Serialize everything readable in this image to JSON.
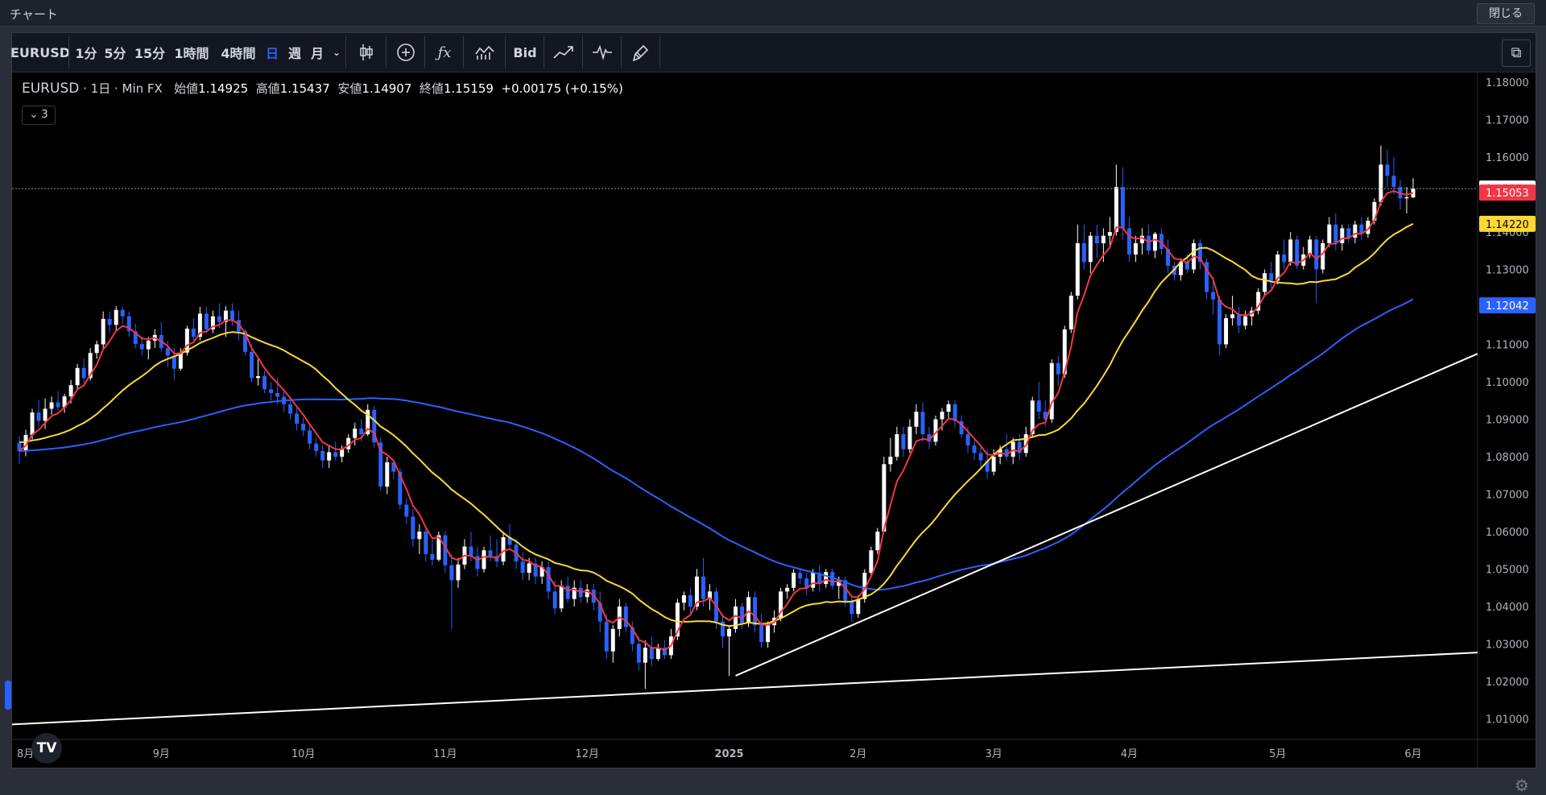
{
  "window": {
    "title": "チャート",
    "close_label": "閉じる"
  },
  "toolbar": {
    "symbol": "EURUSD",
    "intervals": [
      "1分",
      "5分",
      "15分",
      "1時間",
      "4時間",
      "日",
      "週",
      "月"
    ],
    "active_interval": "日",
    "bid_label": "Bid",
    "icons": [
      "dropdown-chevron-icon",
      "candle-style-icon",
      "add-compare-icon",
      "indicators-icon",
      "templates-icon",
      "replay-line-icon",
      "pulse-icon",
      "brush-icon",
      "layout-icon"
    ]
  },
  "legend": {
    "symbol": "EURUSD",
    "interval": "1日",
    "source": "Min FX",
    "open_label": "始値",
    "open": "1.14925",
    "high_label": "高値",
    "high": "1.15437",
    "low_label": "安値",
    "low": "1.14907",
    "close_label": "終値",
    "close": "1.15159",
    "change": "+0.00175 (+0.15%)",
    "collapse_count": "3",
    "colors": {
      "up": "#ffffff",
      "down": "#2962ff"
    }
  },
  "chart_data": {
    "type": "candlestick",
    "y_ticks": [
      "1.18000",
      "1.17000",
      "1.16000",
      "1.15000",
      "1.14000",
      "1.13000",
      "1.12000",
      "1.11000",
      "1.10000",
      "1.09000",
      "1.08000",
      "1.07000",
      "1.06000",
      "1.05000",
      "1.04000",
      "1.03000",
      "1.02000",
      "1.01000"
    ],
    "y_range": [
      1.0045,
      1.1826
    ],
    "x_labels": [
      "8月",
      "9月",
      "10月",
      "11月",
      "12月",
      "2025",
      "2月",
      "3月",
      "4月",
      "5月",
      "6月"
    ],
    "price_tags": [
      {
        "value": "1.15159",
        "color": "#ffffff"
      },
      {
        "value": "1.15053",
        "color": "#f23645"
      },
      {
        "value": "1.14220",
        "color": "#fdd835"
      },
      {
        "value": "1.12042",
        "color": "#2962ff"
      }
    ],
    "candles": [
      [
        1.0836,
        1.0855,
        1.078,
        1.0815
      ],
      [
        1.0815,
        1.0872,
        1.0801,
        1.0858
      ],
      [
        1.0858,
        1.0928,
        1.0846,
        1.0918
      ],
      [
        1.0918,
        1.0952,
        1.088,
        1.0896
      ],
      [
        1.0896,
        1.0955,
        1.0874,
        1.0928
      ],
      [
        1.0928,
        1.0961,
        1.0912,
        1.0945
      ],
      [
        1.0945,
        1.0975,
        1.0925,
        1.0932
      ],
      [
        1.0932,
        1.0968,
        1.0917,
        1.0961
      ],
      [
        1.0961,
        1.1005,
        1.0942,
        1.0991
      ],
      [
        1.0991,
        1.1048,
        1.0977,
        1.1037
      ],
      [
        1.1037,
        1.1062,
        1.0996,
        1.101
      ],
      [
        1.101,
        1.109,
        1.1003,
        1.1077
      ],
      [
        1.1077,
        1.111,
        1.1062,
        1.11
      ],
      [
        1.11,
        1.1188,
        1.1085,
        1.1168
      ],
      [
        1.1168,
        1.1188,
        1.113,
        1.1152
      ],
      [
        1.1152,
        1.1202,
        1.1135,
        1.1192
      ],
      [
        1.1192,
        1.12,
        1.1155,
        1.1175
      ],
      [
        1.1175,
        1.1188,
        1.112,
        1.1135
      ],
      [
        1.1135,
        1.1155,
        1.1089,
        1.1101
      ],
      [
        1.1101,
        1.112,
        1.107,
        1.1087
      ],
      [
        1.1087,
        1.112,
        1.106,
        1.111
      ],
      [
        1.111,
        1.114,
        1.109,
        1.1125
      ],
      [
        1.1125,
        1.116,
        1.108,
        1.109
      ],
      [
        1.109,
        1.111,
        1.104,
        1.107
      ],
      [
        1.107,
        1.109,
        1.1005,
        1.1035
      ],
      [
        1.1035,
        1.109,
        1.103,
        1.1078
      ],
      [
        1.1078,
        1.115,
        1.107,
        1.1142
      ],
      [
        1.1142,
        1.117,
        1.111,
        1.112
      ],
      [
        1.112,
        1.12,
        1.111,
        1.1182
      ],
      [
        1.1182,
        1.12,
        1.113,
        1.114
      ],
      [
        1.114,
        1.119,
        1.113,
        1.1175
      ],
      [
        1.1175,
        1.121,
        1.1145,
        1.116
      ],
      [
        1.116,
        1.1202,
        1.112,
        1.119
      ],
      [
        1.119,
        1.121,
        1.115,
        1.1165
      ],
      [
        1.1165,
        1.119,
        1.111,
        1.1135
      ],
      [
        1.1135,
        1.114,
        1.107,
        1.108
      ],
      [
        1.108,
        1.11,
        1.1,
        1.101
      ],
      [
        1.101,
        1.106,
        1.099,
        1.1015
      ],
      [
        1.1015,
        1.103,
        1.097,
        1.098
      ],
      [
        1.098,
        1.1,
        1.095,
        1.097
      ],
      [
        1.097,
        1.101,
        1.094,
        1.096
      ],
      [
        1.096,
        1.098,
        1.092,
        1.094
      ],
      [
        1.094,
        1.096,
        1.09,
        1.0915
      ],
      [
        1.0915,
        1.093,
        1.087,
        1.0888
      ],
      [
        1.0888,
        1.0905,
        1.0855,
        1.087
      ],
      [
        1.087,
        1.0885,
        1.082,
        1.0835
      ],
      [
        1.0835,
        1.085,
        1.08,
        1.0815
      ],
      [
        1.0815,
        1.083,
        1.077,
        1.079
      ],
      [
        1.079,
        1.083,
        1.077,
        1.0812
      ],
      [
        1.0812,
        1.084,
        1.079,
        1.08
      ],
      [
        1.08,
        1.083,
        1.0785,
        1.082
      ],
      [
        1.082,
        1.086,
        1.081,
        1.085
      ],
      [
        1.085,
        1.089,
        1.083,
        1.0875
      ],
      [
        1.0875,
        1.09,
        1.084,
        1.086
      ],
      [
        1.086,
        1.094,
        1.0855,
        1.0925
      ],
      [
        1.0925,
        1.0935,
        1.0825,
        1.0838
      ],
      [
        1.0838,
        1.085,
        1.071,
        1.072
      ],
      [
        1.072,
        1.08,
        1.07,
        1.0785
      ],
      [
        1.0785,
        1.079,
        1.074,
        1.076
      ],
      [
        1.076,
        1.077,
        1.066,
        1.0672
      ],
      [
        1.0672,
        1.069,
        1.062,
        1.064
      ],
      [
        1.064,
        1.066,
        1.056,
        1.058
      ],
      [
        1.058,
        1.062,
        1.054,
        1.06
      ],
      [
        1.06,
        1.061,
        1.052,
        1.054
      ],
      [
        1.054,
        1.058,
        1.051,
        1.0525
      ],
      [
        1.0525,
        1.06,
        1.052,
        1.059
      ],
      [
        1.059,
        1.06,
        1.049,
        1.051
      ],
      [
        1.051,
        1.054,
        1.034,
        1.047
      ],
      [
        1.047,
        1.053,
        1.045,
        1.0512
      ],
      [
        1.0512,
        1.058,
        1.05,
        1.056
      ],
      [
        1.056,
        1.06,
        1.052,
        1.0535
      ],
      [
        1.0535,
        1.056,
        1.048,
        1.05
      ],
      [
        1.05,
        1.056,
        1.049,
        1.055
      ],
      [
        1.055,
        1.059,
        1.052,
        1.0535
      ],
      [
        1.0535,
        1.058,
        1.0505,
        1.052
      ],
      [
        1.052,
        1.06,
        1.051,
        1.0585
      ],
      [
        1.0585,
        1.062,
        1.055,
        1.0565
      ],
      [
        1.0565,
        1.058,
        1.05,
        1.052
      ],
      [
        1.052,
        1.0545,
        1.047,
        1.049
      ],
      [
        1.049,
        1.053,
        1.047,
        1.0515
      ],
      [
        1.0515,
        1.053,
        1.046,
        1.048
      ],
      [
        1.048,
        1.052,
        1.046,
        1.0505
      ],
      [
        1.0505,
        1.052,
        1.042,
        1.044
      ],
      [
        1.044,
        1.047,
        1.038,
        1.0395
      ],
      [
        1.0395,
        1.047,
        1.0385,
        1.0455
      ],
      [
        1.0455,
        1.048,
        1.041,
        1.042
      ],
      [
        1.042,
        1.047,
        1.04,
        1.045
      ],
      [
        1.045,
        1.047,
        1.041,
        1.0425
      ],
      [
        1.0425,
        1.046,
        1.041,
        1.0445
      ],
      [
        1.0445,
        1.046,
        1.039,
        1.041
      ],
      [
        1.041,
        1.044,
        1.033,
        1.036
      ],
      [
        1.036,
        1.038,
        1.026,
        1.028
      ],
      [
        1.028,
        1.035,
        1.025,
        1.034
      ],
      [
        1.034,
        1.042,
        1.032,
        1.04
      ],
      [
        1.04,
        1.041,
        1.033,
        1.0345
      ],
      [
        1.0345,
        1.036,
        1.028,
        1.03
      ],
      [
        1.03,
        1.032,
        1.023,
        1.025
      ],
      [
        1.025,
        1.031,
        1.018,
        1.029
      ],
      [
        1.029,
        1.032,
        1.024,
        1.026
      ],
      [
        1.026,
        1.03,
        1.0255,
        1.029
      ],
      [
        1.029,
        1.031,
        1.026,
        1.027
      ],
      [
        1.027,
        1.034,
        1.026,
        1.032
      ],
      [
        1.032,
        1.042,
        1.031,
        1.041
      ],
      [
        1.041,
        1.044,
        1.039,
        1.043
      ],
      [
        1.043,
        1.045,
        1.038,
        1.04
      ],
      [
        1.04,
        1.05,
        1.039,
        1.048
      ],
      [
        1.048,
        1.053,
        1.04,
        1.042
      ],
      [
        1.042,
        1.046,
        1.039,
        1.044
      ],
      [
        1.044,
        1.045,
        1.034,
        1.036
      ],
      [
        1.036,
        1.038,
        1.029,
        1.032
      ],
      [
        1.032,
        1.035,
        1.0215,
        1.034
      ],
      [
        1.034,
        1.042,
        1.033,
        1.04
      ],
      [
        1.04,
        1.041,
        1.034,
        1.0355
      ],
      [
        1.0355,
        1.044,
        1.0345,
        1.0425
      ],
      [
        1.0425,
        1.044,
        1.033,
        1.035
      ],
      [
        1.035,
        1.038,
        1.029,
        1.0305
      ],
      [
        1.0305,
        1.036,
        1.029,
        1.035
      ],
      [
        1.035,
        1.039,
        1.033,
        1.037
      ],
      [
        1.037,
        1.045,
        1.036,
        1.044
      ],
      [
        1.044,
        1.046,
        1.042,
        1.045
      ],
      [
        1.045,
        1.05,
        1.044,
        1.049
      ],
      [
        1.049,
        1.05,
        1.046,
        1.0475
      ],
      [
        1.0475,
        1.049,
        1.043,
        1.045
      ],
      [
        1.045,
        1.05,
        1.044,
        1.049
      ],
      [
        1.049,
        1.051,
        1.044,
        1.046
      ],
      [
        1.046,
        1.05,
        1.045,
        1.0492
      ],
      [
        1.0492,
        1.05,
        1.0445,
        1.0455
      ],
      [
        1.0455,
        1.048,
        1.042,
        1.047
      ],
      [
        1.047,
        1.048,
        1.04,
        1.0415
      ],
      [
        1.0415,
        1.043,
        1.036,
        1.038
      ],
      [
        1.038,
        1.043,
        1.037,
        1.042
      ],
      [
        1.042,
        1.05,
        1.041,
        1.049
      ],
      [
        1.049,
        1.056,
        1.048,
        1.055
      ],
      [
        1.055,
        1.061,
        1.054,
        1.06
      ],
      [
        1.06,
        1.08,
        1.06,
        1.078
      ],
      [
        1.078,
        1.085,
        1.076,
        1.08
      ],
      [
        1.08,
        1.088,
        1.079,
        1.086
      ],
      [
        1.086,
        1.088,
        1.08,
        1.082
      ],
      [
        1.082,
        1.09,
        1.081,
        1.088
      ],
      [
        1.088,
        1.094,
        1.086,
        1.092
      ],
      [
        1.092,
        1.0945,
        1.084,
        1.086
      ],
      [
        1.086,
        1.088,
        1.082,
        1.084
      ],
      [
        1.084,
        1.091,
        1.083,
        1.09
      ],
      [
        1.09,
        1.093,
        1.087,
        1.092
      ],
      [
        1.092,
        1.095,
        1.09,
        1.094
      ],
      [
        1.094,
        1.095,
        1.088,
        1.0895
      ],
      [
        1.0895,
        1.091,
        1.085,
        1.086
      ],
      [
        1.086,
        1.088,
        1.081,
        1.083
      ],
      [
        1.083,
        1.085,
        1.079,
        1.081
      ],
      [
        1.081,
        1.083,
        1.077,
        1.079
      ],
      [
        1.079,
        1.082,
        1.074,
        1.076
      ],
      [
        1.076,
        1.082,
        1.075,
        1.08
      ],
      [
        1.08,
        1.083,
        1.078,
        1.082
      ],
      [
        1.082,
        1.086,
        1.079,
        1.08
      ],
      [
        1.08,
        1.085,
        1.078,
        1.084
      ],
      [
        1.084,
        1.086,
        1.079,
        1.081
      ],
      [
        1.081,
        1.088,
        1.08,
        1.086
      ],
      [
        1.086,
        1.096,
        1.085,
        1.095
      ],
      [
        1.095,
        1.1,
        1.09,
        1.092
      ],
      [
        1.092,
        1.095,
        1.088,
        1.09
      ],
      [
        1.09,
        1.106,
        1.089,
        1.105
      ],
      [
        1.105,
        1.107,
        1.099,
        1.102
      ],
      [
        1.102,
        1.115,
        1.101,
        1.114
      ],
      [
        1.114,
        1.124,
        1.113,
        1.123
      ],
      [
        1.123,
        1.142,
        1.122,
        1.137
      ],
      [
        1.137,
        1.142,
        1.13,
        1.132
      ],
      [
        1.132,
        1.14,
        1.129,
        1.139
      ],
      [
        1.139,
        1.142,
        1.133,
        1.137
      ],
      [
        1.137,
        1.141,
        1.132,
        1.139
      ],
      [
        1.139,
        1.144,
        1.136,
        1.14
      ],
      [
        1.14,
        1.158,
        1.139,
        1.152
      ],
      [
        1.152,
        1.1573,
        1.138,
        1.141
      ],
      [
        1.141,
        1.144,
        1.132,
        1.134
      ],
      [
        1.134,
        1.139,
        1.132,
        1.137
      ],
      [
        1.137,
        1.141,
        1.134,
        1.139
      ],
      [
        1.139,
        1.142,
        1.134,
        1.135
      ],
      [
        1.135,
        1.14,
        1.133,
        1.1395
      ],
      [
        1.1395,
        1.141,
        1.134,
        1.1355
      ],
      [
        1.1355,
        1.138,
        1.129,
        1.131
      ],
      [
        1.131,
        1.132,
        1.127,
        1.1285
      ],
      [
        1.1285,
        1.133,
        1.127,
        1.132
      ],
      [
        1.132,
        1.134,
        1.129,
        1.13
      ],
      [
        1.13,
        1.138,
        1.129,
        1.137
      ],
      [
        1.137,
        1.138,
        1.13,
        1.132
      ],
      [
        1.132,
        1.133,
        1.122,
        1.124
      ],
      [
        1.124,
        1.128,
        1.118,
        1.122
      ],
      [
        1.122,
        1.123,
        1.107,
        1.11
      ],
      [
        1.11,
        1.118,
        1.109,
        1.117
      ],
      [
        1.117,
        1.123,
        1.115,
        1.118
      ],
      [
        1.118,
        1.12,
        1.113,
        1.115
      ],
      [
        1.115,
        1.119,
        1.114,
        1.1175
      ],
      [
        1.1175,
        1.12,
        1.115,
        1.119
      ],
      [
        1.119,
        1.125,
        1.118,
        1.124
      ],
      [
        1.124,
        1.13,
        1.123,
        1.129
      ],
      [
        1.129,
        1.132,
        1.125,
        1.127
      ],
      [
        1.127,
        1.135,
        1.126,
        1.134
      ],
      [
        1.134,
        1.138,
        1.13,
        1.132
      ],
      [
        1.132,
        1.14,
        1.131,
        1.138
      ],
      [
        1.138,
        1.139,
        1.13,
        1.131
      ],
      [
        1.131,
        1.136,
        1.13,
        1.134
      ],
      [
        1.134,
        1.139,
        1.133,
        1.138
      ],
      [
        1.138,
        1.139,
        1.121,
        1.13
      ],
      [
        1.13,
        1.138,
        1.129,
        1.137
      ],
      [
        1.137,
        1.144,
        1.136,
        1.142
      ],
      [
        1.142,
        1.145,
        1.135,
        1.137
      ],
      [
        1.137,
        1.142,
        1.135,
        1.141
      ],
      [
        1.141,
        1.142,
        1.137,
        1.1385
      ],
      [
        1.1385,
        1.143,
        1.137,
        1.142
      ],
      [
        1.142,
        1.144,
        1.138,
        1.1395
      ],
      [
        1.1395,
        1.144,
        1.1385,
        1.143
      ],
      [
        1.143,
        1.149,
        1.142,
        1.148
      ],
      [
        1.148,
        1.1631,
        1.147,
        1.158
      ],
      [
        1.158,
        1.162,
        1.152,
        1.155
      ],
      [
        1.155,
        1.16,
        1.15,
        1.152
      ],
      [
        1.152,
        1.154,
        1.146,
        1.149
      ],
      [
        1.149,
        1.152,
        1.145,
        1.1493
      ],
      [
        1.14925,
        1.15437,
        1.14907,
        1.15159
      ]
    ]
  }
}
